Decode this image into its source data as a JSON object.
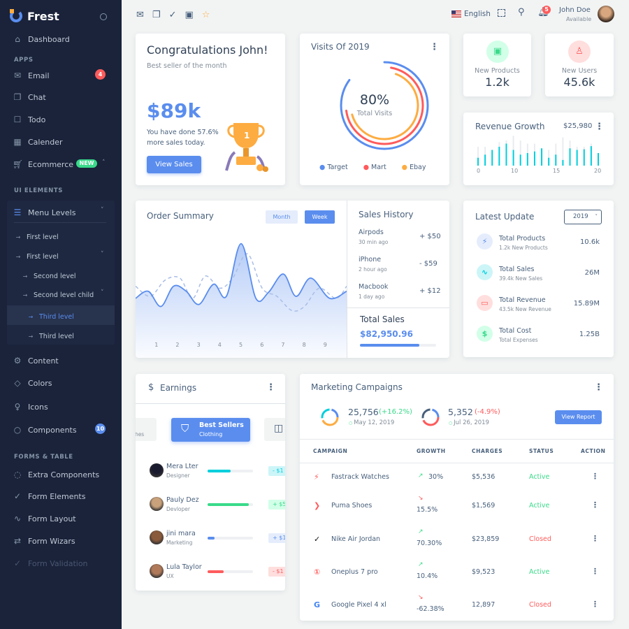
{
  "brand": {
    "name": "Frest"
  },
  "sidebar": {
    "items": [
      {
        "label": "Dashboard",
        "icon": "home-icon"
      },
      {
        "label": "Email",
        "icon": "mail-icon",
        "badge": "4"
      },
      {
        "label": "Chat",
        "icon": "chat-icon"
      },
      {
        "label": "Todo",
        "icon": "square-icon"
      },
      {
        "label": "Calender",
        "icon": "calendar-icon"
      },
      {
        "label": "Ecommerce",
        "icon": "cart-icon",
        "badge": "NEW"
      },
      {
        "label": "Menu Levels",
        "icon": "menu-icon"
      },
      {
        "label": "First level"
      },
      {
        "label": "First level"
      },
      {
        "label": "Second level"
      },
      {
        "label": "Second level child"
      },
      {
        "label": "Third level"
      },
      {
        "label": "Third level"
      },
      {
        "label": "Content",
        "icon": "grid-icon"
      },
      {
        "label": "Colors",
        "icon": "droplet-icon"
      },
      {
        "label": "Icons",
        "icon": "bulb-icon"
      },
      {
        "label": "Components",
        "icon": "circle-icon",
        "badge": "10"
      },
      {
        "label": "Extra Components",
        "icon": "spinner-icon"
      },
      {
        "label": "Form Elements",
        "icon": "check-icon"
      },
      {
        "label": "Form Layout",
        "icon": "pulse-icon"
      },
      {
        "label": "Form Wizars",
        "icon": "arrows-icon"
      },
      {
        "label": "Form Validation",
        "icon": "check-icon"
      }
    ],
    "headers": [
      "APPS",
      "UI ELEMENTS",
      "FORMS & TABLE"
    ]
  },
  "topbar": {
    "language": "English",
    "notifications": "5",
    "user_name": "John Doe",
    "user_status": "Available"
  },
  "congrats": {
    "title": "Congratulations John!",
    "subtitle": "Best seller of the month",
    "amount": "$89k",
    "text1": "You have done 57.6%",
    "text2": "more sales today.",
    "button": "View Sales"
  },
  "visits": {
    "title": "Visits Of 2019",
    "percent": "80%",
    "label": "Total Visits",
    "legend": [
      "Target",
      "Mart",
      "Ebay"
    ],
    "colors": [
      "#5a8dee",
      "#ff5b5c",
      "#fdac41"
    ],
    "arcs": [
      0.85,
      0.7,
      0.65
    ]
  },
  "stats": [
    {
      "label": "New Products",
      "value": "1.2k"
    },
    {
      "label": "New Users",
      "value": "45.6k"
    }
  ],
  "revenue": {
    "title": "Revenue Growth",
    "amount": "$25,980",
    "ticks": [
      "0",
      "10",
      "15",
      "20"
    ],
    "values": [
      25,
      35,
      50,
      60,
      70,
      50,
      35,
      40,
      45,
      55,
      25,
      35,
      18,
      55,
      50,
      52,
      62,
      40
    ],
    "backgrounds": [
      60,
      60,
      50,
      75,
      80,
      95,
      80,
      70,
      70,
      55,
      50,
      70,
      90,
      80,
      60,
      60,
      70,
      40
    ]
  },
  "order": {
    "title": "Order Summary",
    "tabs": [
      "Month",
      "Week"
    ],
    "x_ticks": [
      "1",
      "2",
      "3",
      "4",
      "5",
      "6",
      "7",
      "8",
      "9"
    ],
    "solid": [
      [
        0,
        38
      ],
      [
        0.6,
        45
      ],
      [
        1.2,
        30
      ],
      [
        1.8,
        50
      ],
      [
        2.4,
        45
      ],
      [
        3,
        32
      ],
      [
        3.7,
        52
      ],
      [
        4.3,
        40
      ],
      [
        5,
        92
      ],
      [
        5.7,
        38
      ],
      [
        6.3,
        44
      ],
      [
        7,
        62
      ],
      [
        7.6,
        40
      ],
      [
        8.3,
        58
      ],
      [
        9.2,
        38
      ],
      [
        10,
        45
      ]
    ],
    "dashed": [
      [
        0,
        50
      ],
      [
        0.7,
        40
      ],
      [
        1.4,
        56
      ],
      [
        2.1,
        58
      ],
      [
        2.7,
        38
      ],
      [
        3.3,
        60
      ],
      [
        4,
        48
      ],
      [
        4.6,
        58
      ],
      [
        5.3,
        82
      ],
      [
        6,
        48
      ],
      [
        6.7,
        40
      ],
      [
        7.4,
        26
      ],
      [
        8,
        30
      ],
      [
        8.7,
        48
      ],
      [
        9.5,
        38
      ],
      [
        10,
        50
      ]
    ],
    "history_title": "Sales History",
    "history": [
      {
        "name": "Airpods",
        "time": "30 min ago",
        "amount": "+ $50",
        "up": true
      },
      {
        "name": "iPhone",
        "time": "2 hour ago",
        "amount": "- $59",
        "up": false
      },
      {
        "name": "Macbook",
        "time": "1 day ago",
        "amount": "+ $12",
        "up": true
      }
    ],
    "total_label": "Total Sales",
    "total": "$82,950.96",
    "total_progress": 0.78
  },
  "latest": {
    "title": "Latest Update",
    "year": "2019",
    "items": [
      {
        "title": "Total Products",
        "sub": "1.2k New Products",
        "value": "10.6k",
        "icon": "bolt-icon",
        "color": "#5a8dee",
        "bg": "#e5edfc"
      },
      {
        "title": "Total Sales",
        "sub": "39.4k New Sales",
        "value": "26M",
        "icon": "pulse-icon",
        "color": "#00cfdd",
        "bg": "#ccf5f8"
      },
      {
        "title": "Total Revenue",
        "sub": "43.5k New Revenue",
        "value": "15.89M",
        "icon": "card-icon",
        "color": "#ff5b5c",
        "bg": "#ffdede"
      },
      {
        "title": "Total Cost",
        "sub": "Total Expenses",
        "value": "1.25B",
        "icon": "dollar-icon",
        "color": "#39da8a",
        "bg": "#d2ffe8"
      }
    ]
  },
  "earnings": {
    "title": "Earnings",
    "left_tab": "thes",
    "tab_title": "Best Sellers",
    "tab_sub": "Clothing",
    "people": [
      {
        "name": "Mera Lter",
        "role": "Designer",
        "progress": 0.5,
        "color": "#00cfdd",
        "amount": "- $1",
        "bg": "#ccf5f8"
      },
      {
        "name": "Pauly Dez",
        "role": "Devloper",
        "progress": 0.9,
        "color": "#39da8a",
        "amount": "+ $5",
        "bg": "#d2ffe8"
      },
      {
        "name": "jini mara",
        "role": "Marketing",
        "progress": 0.15,
        "color": "#5a8dee",
        "amount": "+ $1",
        "bg": "#e5edfc"
      },
      {
        "name": "Lula Taylor",
        "role": "UX",
        "progress": 0.35,
        "color": "#ff5b5c",
        "amount": "- $1",
        "bg": "#ffdede"
      }
    ]
  },
  "marketing": {
    "title": "Marketing Campaigns",
    "stat1": {
      "value": "25,756",
      "change": "(+16.2%)",
      "date": "May 12, 2019"
    },
    "stat2": {
      "value": "5,352",
      "change": "(-4.9%)",
      "date": "Jul 26, 2019"
    },
    "button": "View Report",
    "columns": [
      "CAMPAIGN",
      "GROWTH",
      "CHARGES",
      "STATUS",
      "ACTION"
    ],
    "rows": [
      {
        "campaign": "Fastrack Watches",
        "growth": "30%",
        "up": true,
        "charges": "$5,536",
        "status": "Active",
        "logo_color": "#ff5b5c"
      },
      {
        "campaign": "Puma Shoes",
        "growth": "15.5%",
        "up": false,
        "charges": "$1,569",
        "status": "Active",
        "logo_color": "#ff5b5c"
      },
      {
        "campaign": "Nike Air Jordan",
        "growth": "70.30%",
        "up": true,
        "charges": "$23,859",
        "status": "Closed",
        "logo_color": "#111"
      },
      {
        "campaign": "Oneplus 7 pro",
        "growth": "10.4%",
        "up": true,
        "charges": "$9,523",
        "status": "Active",
        "logo_color": "#ff5b5c"
      },
      {
        "campaign": "Google Pixel 4 xl",
        "growth": "-62.38%",
        "up": false,
        "charges": "12,897",
        "status": "Closed",
        "logo_color": "#4285f4"
      }
    ]
  }
}
